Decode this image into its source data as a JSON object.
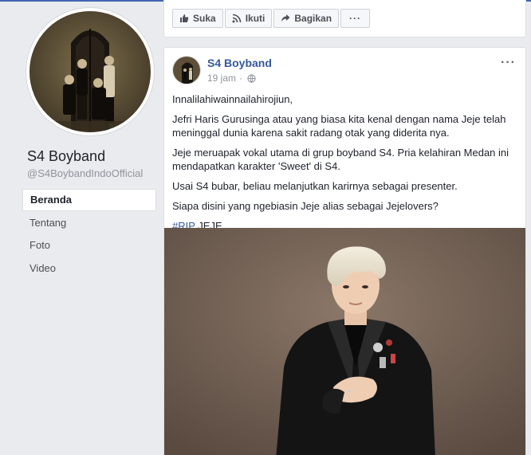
{
  "page": {
    "name": "S4 Boyband",
    "handle": "@S4BoybandIndoOfficial"
  },
  "nav": {
    "items": [
      {
        "label": "Beranda"
      },
      {
        "label": "Tentang"
      },
      {
        "label": "Foto"
      },
      {
        "label": "Video"
      }
    ]
  },
  "actions": {
    "like": "Suka",
    "follow": "Ikuti",
    "share": "Bagikan",
    "more": "···"
  },
  "post": {
    "author": "S4 Boyband",
    "time": "19 jam",
    "options": "···",
    "paragraphs": [
      "Innalilahiwainnailahirojiun,",
      "Jefri Haris Gurusinga atau yang biasa kita kenal dengan nama Jeje telah meninggal dunia karena sakit radang otak yang diderita nya.",
      "Jeje meruapak vokal utama di grup boyband S4. Pria kelahiran Medan ini mendapatkan karakter 'Sweet' di S4.",
      "Usai S4 bubar, beliau melanjutkan karirnya sebagai presenter.",
      "Siapa disini yang ngebiasin Jeje alias sebagai Jejelovers?"
    ],
    "hashtag": "#RIP",
    "hashtag_suffix": " JEJE"
  },
  "colors": {
    "link": "#365899",
    "accent": "#4267b2",
    "background": "#e9ebee"
  },
  "icons": {
    "like": "thumbs-up-icon",
    "follow": "rss-icon",
    "share": "share-arrow-icon",
    "privacy": "globe-icon"
  }
}
